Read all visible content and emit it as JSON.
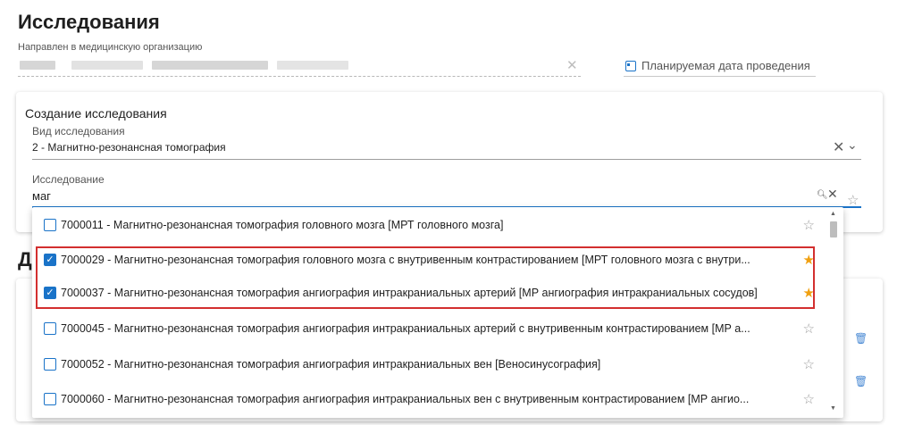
{
  "page": {
    "title": "Исследования",
    "section2_title_visible": "Д"
  },
  "org": {
    "label": "Направлен в медицинскую организацию",
    "clear_icon": "close-icon"
  },
  "planned_date": {
    "label": "Планируемая дата проведения",
    "icon": "calendar-icon"
  },
  "create": {
    "title": "Создание исследования",
    "kind_label": "Вид исследования",
    "kind_value": "2 - Магнитно-резонансная томография",
    "study_label": "Исследование",
    "study_query": "маг"
  },
  "glyphs": {
    "close": "✕",
    "chevron": "⌄",
    "search": "🔍︎",
    "star_outline": "☆",
    "star_filled": "★",
    "check": "✓",
    "scroll_up": "▲",
    "scroll_down": "▼",
    "trash": "🗑︎"
  },
  "options": [
    {
      "text": "7000011 - Магнитно-резонансная томография головного мозга [МРТ головного мозга]",
      "checked": false,
      "favorite": false
    },
    {
      "text": "7000029 - Магнитно-резонансная томография головного мозга с внутривенным контрастированием [МРТ головного мозга с внутри...",
      "checked": true,
      "favorite": true
    },
    {
      "text": "7000037 - Магнитно-резонансная томография ангиография интракраниальных артерий [МР ангиография интракраниальных сосудов]",
      "checked": true,
      "favorite": true
    },
    {
      "text": "7000045 - Магнитно-резонансная томография ангиография интракраниальных артерий с внутривенным контрастированием [МР а...",
      "checked": false,
      "favorite": false
    },
    {
      "text": "7000052 - Магнитно-резонансная томография ангиография интракраниальных вен [Веносинусография]",
      "checked": false,
      "favorite": false
    },
    {
      "text": "7000060 - Магнитно-резонансная томография ангиография интракраниальных вен с внутривенным контрастированием [МР ангио...",
      "checked": false,
      "favorite": false
    }
  ],
  "colors": {
    "accent": "#1a73c8",
    "favorite": "#f0a010",
    "highlight": "#d32f2f"
  }
}
